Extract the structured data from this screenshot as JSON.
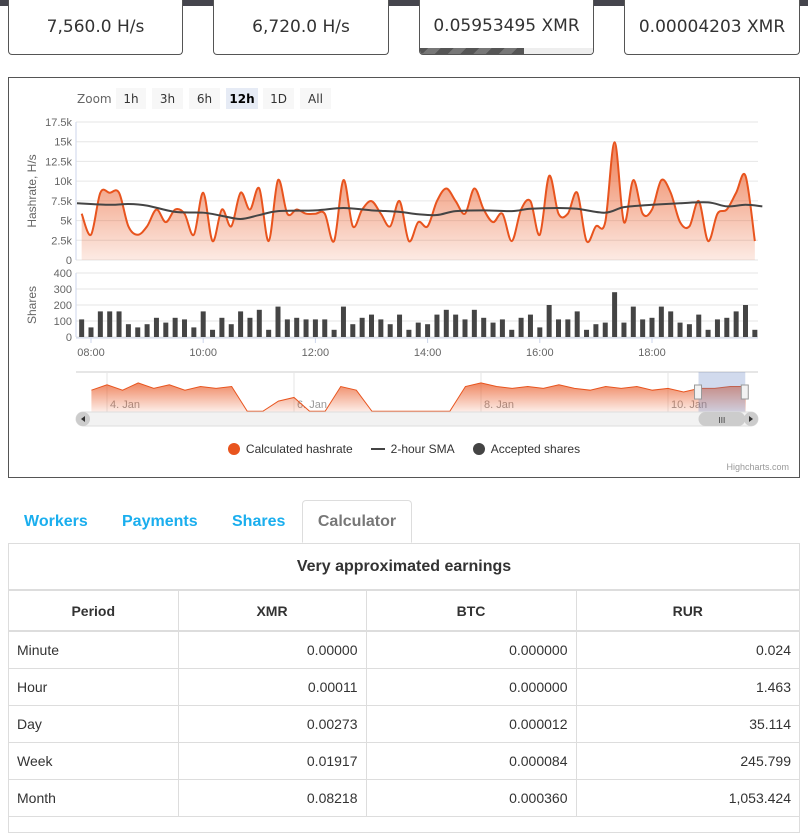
{
  "stats": [
    {
      "value": "7,560.0 H/s"
    },
    {
      "value": "6,720.0 H/s"
    },
    {
      "value": "0.05953495 XMR",
      "progress": 0.6
    },
    {
      "value": "0.00004203 XMR"
    }
  ],
  "zoom": {
    "label": "Zoom",
    "buttons": [
      "1h",
      "3h",
      "6h",
      "12h",
      "1D",
      "All"
    ],
    "selected": "12h"
  },
  "chart_data": {
    "type": "area",
    "colors": {
      "hashrate": "#e8541e",
      "sma": "#444444",
      "shares": "#444444"
    },
    "hashrate_axis": {
      "label": "Hashrate, H/s",
      "ticks": [
        "0",
        "2.5k",
        "5k",
        "7.5k",
        "10k",
        "12.5k",
        "15k",
        "17.5k"
      ],
      "ylim": [
        0,
        17500
      ]
    },
    "shares_axis": {
      "label": "Shares",
      "ticks": [
        "0",
        "100",
        "200",
        "300",
        "400"
      ],
      "ylim": [
        0,
        400
      ]
    },
    "x_ticks": [
      "08:00",
      "10:00",
      "12:00",
      "14:00",
      "16:00",
      "18:00"
    ],
    "x": [
      "07:50",
      "08:00",
      "08:10",
      "08:20",
      "08:30",
      "08:40",
      "08:50",
      "09:00",
      "09:10",
      "09:20",
      "09:30",
      "09:40",
      "09:50",
      "10:00",
      "10:10",
      "10:20",
      "10:30",
      "10:40",
      "10:50",
      "11:00",
      "11:10",
      "11:20",
      "11:30",
      "11:40",
      "11:50",
      "12:00",
      "12:10",
      "12:20",
      "12:30",
      "12:40",
      "12:50",
      "13:00",
      "13:10",
      "13:20",
      "13:30",
      "13:40",
      "13:50",
      "14:00",
      "14:10",
      "14:20",
      "14:30",
      "14:40",
      "14:50",
      "15:00",
      "15:10",
      "15:20",
      "15:30",
      "15:40",
      "15:50",
      "16:00",
      "16:10",
      "16:20",
      "16:30",
      "16:40",
      "16:50",
      "17:00",
      "17:10",
      "17:20",
      "17:30",
      "17:40",
      "17:50",
      "18:00",
      "18:10",
      "18:20",
      "18:30",
      "18:40",
      "18:50",
      "19:00",
      "19:10",
      "19:20",
      "19:30",
      "19:40",
      "19:50"
    ],
    "series": [
      {
        "name": "Calculated hashrate",
        "type": "area",
        "values": [
          5870,
          3200,
          8530,
          8530,
          8530,
          4270,
          3200,
          4270,
          6400,
          4800,
          6400,
          5870,
          3200,
          8530,
          2400,
          6400,
          4270,
          8530,
          6400,
          9070,
          2400,
          10130,
          5870,
          6400,
          5870,
          5870,
          5870,
          2400,
          10130,
          4270,
          6400,
          7470,
          5870,
          4270,
          7470,
          2400,
          4800,
          4270,
          7470,
          9070,
          7470,
          5870,
          9070,
          6400,
          4800,
          5870,
          2400,
          6400,
          7470,
          3200,
          10670,
          5870,
          5870,
          8530,
          2400,
          4270,
          4800,
          14930,
          4800,
          10130,
          5870,
          6400,
          10130,
          8530,
          4800,
          4270,
          7470,
          2400,
          5870,
          6400,
          8530,
          10670,
          2400
        ]
      },
      {
        "name": "2-hour SMA",
        "type": "line",
        "points": [
          [
            "07:45",
            7200
          ],
          [
            "08:20",
            7000
          ],
          [
            "08:40",
            7100
          ],
          [
            "09:00",
            6900
          ],
          [
            "09:30",
            6100
          ],
          [
            "10:00",
            6000
          ],
          [
            "10:20",
            5600
          ],
          [
            "10:40",
            5200
          ],
          [
            "11:00",
            5700
          ],
          [
            "11:20",
            6200
          ],
          [
            "12:00",
            6300
          ],
          [
            "12:30",
            6600
          ],
          [
            "13:00",
            6300
          ],
          [
            "13:30",
            6100
          ],
          [
            "13:50",
            5800
          ],
          [
            "14:10",
            5700
          ],
          [
            "14:30",
            6200
          ],
          [
            "15:00",
            6300
          ],
          [
            "15:30",
            6200
          ],
          [
            "15:50",
            6500
          ],
          [
            "16:20",
            6600
          ],
          [
            "16:40",
            6500
          ],
          [
            "17:10",
            6000
          ],
          [
            "17:30",
            6700
          ],
          [
            "18:00",
            7000
          ],
          [
            "18:30",
            7200
          ],
          [
            "19:00",
            7300
          ],
          [
            "19:20",
            6800
          ],
          [
            "19:40",
            7000
          ],
          [
            "19:58",
            6800
          ]
        ]
      },
      {
        "name": "Accepted shares",
        "type": "column",
        "values": [
          110,
          60,
          160,
          160,
          160,
          80,
          60,
          80,
          120,
          90,
          120,
          110,
          60,
          160,
          45,
          120,
          80,
          160,
          120,
          170,
          45,
          190,
          110,
          120,
          110,
          110,
          110,
          45,
          190,
          80,
          120,
          140,
          110,
          80,
          140,
          45,
          90,
          80,
          140,
          170,
          140,
          110,
          170,
          120,
          90,
          110,
          45,
          120,
          140,
          60,
          200,
          110,
          110,
          160,
          45,
          80,
          90,
          280,
          90,
          190,
          110,
          120,
          190,
          160,
          90,
          80,
          140,
          45,
          110,
          120,
          160,
          200,
          45
        ]
      }
    ],
    "navigator": {
      "x_ticks": [
        "4. Jan",
        "6. Jan",
        "8. Jan",
        "10. Jan"
      ],
      "points": [
        [
          "3 Jan 20:00",
          6000
        ],
        [
          "4 Jan 00:00",
          7500
        ],
        [
          "4 Jan 04:00",
          6000
        ],
        [
          "4 Jan 08:00",
          8000
        ],
        [
          "4 Jan 12:00",
          6500
        ],
        [
          "4 Jan 16:00",
          7500
        ],
        [
          "4 Jan 20:00",
          6000
        ],
        [
          "5 Jan 00:00",
          7000
        ],
        [
          "5 Jan 04:00",
          6500
        ],
        [
          "5 Jan 08:00",
          7000
        ],
        [
          "5 Jan 12:00",
          200
        ],
        [
          "5 Jan 16:00",
          200
        ],
        [
          "5 Jan 20:00",
          3000
        ],
        [
          "6 Jan 00:00",
          4000
        ],
        [
          "6 Jan 04:00",
          200
        ],
        [
          "6 Jan 08:00",
          200
        ],
        [
          "6 Jan 12:00",
          7000
        ],
        [
          "6 Jan 16:00",
          6000
        ],
        [
          "6 Jan 20:00",
          200
        ],
        [
          "7 Jan 00:00",
          200
        ],
        [
          "7 Jan 04:00",
          200
        ],
        [
          "7 Jan 08:00",
          200
        ],
        [
          "7 Jan 12:00",
          200
        ],
        [
          "7 Jan 16:00",
          200
        ],
        [
          "7 Jan 20:00",
          7000
        ],
        [
          "8 Jan 00:00",
          8000
        ],
        [
          "8 Jan 04:00",
          7000
        ],
        [
          "8 Jan 08:00",
          6500
        ],
        [
          "8 Jan 12:00",
          7000
        ],
        [
          "8 Jan 16:00",
          6500
        ],
        [
          "8 Jan 20:00",
          7500
        ],
        [
          "9 Jan 00:00",
          6500
        ],
        [
          "9 Jan 04:00",
          6000
        ],
        [
          "9 Jan 08:00",
          7000
        ],
        [
          "9 Jan 12:00",
          6500
        ],
        [
          "9 Jan 16:00",
          7000
        ],
        [
          "9 Jan 20:00",
          6000
        ],
        [
          "10 Jan 00:00",
          6500
        ],
        [
          "10 Jan 04:00",
          5500
        ],
        [
          "10 Jan 08:00",
          6500
        ],
        [
          "10 Jan 12:00",
          6500
        ],
        [
          "10 Jan 16:00",
          7000
        ],
        [
          "10 Jan 20:00",
          7000
        ]
      ],
      "selected": [
        "10 Jan 07:50",
        "10 Jan 19:50"
      ]
    },
    "legend": [
      "Calculated hashrate",
      "2-hour SMA",
      "Accepted shares"
    ],
    "legend_placement": "bottom",
    "grid": true,
    "credits": "Highcharts.com"
  },
  "tabs": [
    {
      "label": "Workers"
    },
    {
      "label": "Payments"
    },
    {
      "label": "Shares"
    },
    {
      "label": "Calculator",
      "active": true
    }
  ],
  "calculator": {
    "title": "Very approximated earnings",
    "headers": [
      "Period",
      "XMR",
      "BTC",
      "RUR"
    ],
    "rows": [
      [
        "Minute",
        "0.00000",
        "0.000000",
        "0.024"
      ],
      [
        "Hour",
        "0.00011",
        "0.000000",
        "1.463"
      ],
      [
        "Day",
        "0.00273",
        "0.000012",
        "35.114"
      ],
      [
        "Week",
        "0.01917",
        "0.000084",
        "245.799"
      ],
      [
        "Month",
        "0.08218",
        "0.000360",
        "1,053.424"
      ]
    ]
  }
}
